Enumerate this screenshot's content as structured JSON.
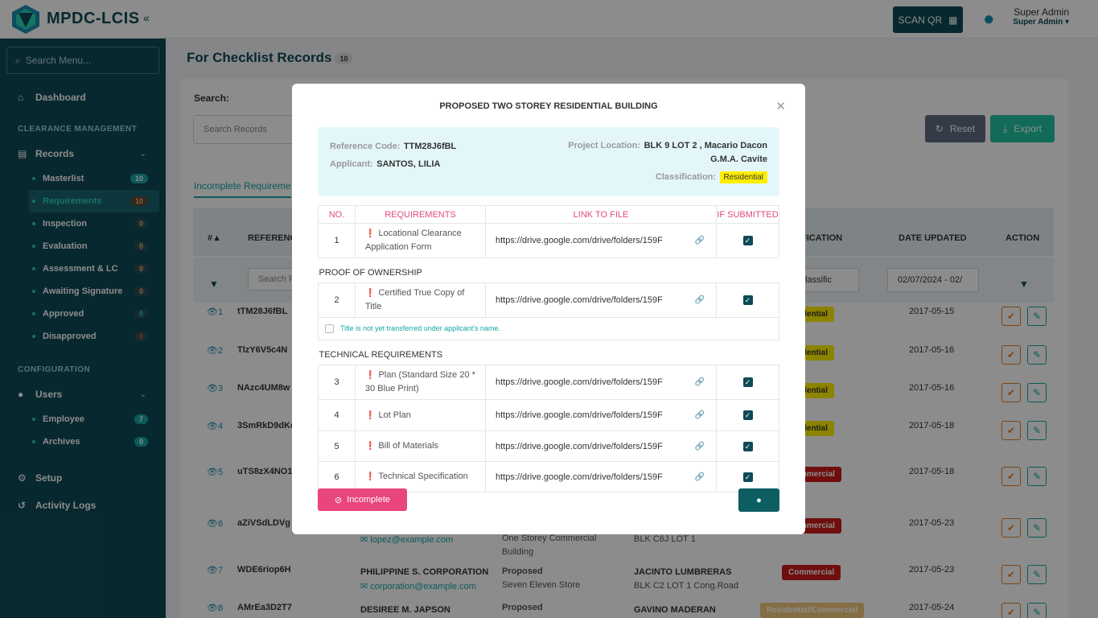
{
  "app": {
    "brand": "MPDC-LCIS",
    "collapse_icon": "«"
  },
  "search_menu": {
    "placeholder": "Search Menu..."
  },
  "nav": {
    "dashboard": "Dashboard",
    "section_clearance": "CLEARANCE MANAGEMENT",
    "records": "Records",
    "records_sub": [
      {
        "label": "Masterlist",
        "count": "10"
      },
      {
        "label": "Requirements",
        "count": "10"
      },
      {
        "label": "Inspection",
        "count": "0"
      },
      {
        "label": "Evaluation",
        "count": "0"
      },
      {
        "label": "Assessment & LC",
        "count": "0"
      },
      {
        "label": "Awaiting Signature",
        "count": "0"
      },
      {
        "label": "Approved",
        "count": "0"
      },
      {
        "label": "Disapproved",
        "count": "0"
      }
    ],
    "section_config": "CONFIGURATION",
    "users": "Users",
    "users_sub": [
      {
        "label": "Employee",
        "count": "7"
      },
      {
        "label": "Archives",
        "count": "0"
      }
    ],
    "setup": "Setup",
    "activity_logs": "Activity Logs"
  },
  "topbar": {
    "scan_qr": "SCAN QR",
    "user_name": "Super Admin",
    "user_role": "Super Admin"
  },
  "page": {
    "title": "For Checklist Records",
    "count": "10",
    "search_label": "Search:",
    "search_placeholder": "Search Records",
    "reset": "Reset",
    "export": "Export",
    "tab": "Incomplete Requireme",
    "columns": {
      "num": "#▲",
      "ref": "REFERENC",
      "classification": "FICATION",
      "date": "DATE UPDATED",
      "action": "ACTION"
    },
    "filter_search": "Search R",
    "filter_class": "Classific",
    "filter_date": "02/07/2024 - 02/",
    "rows": [
      {
        "n": "1",
        "ref": "tTM28J6fBL",
        "badge": "idential",
        "date": "2017-05-15"
      },
      {
        "n": "2",
        "ref": "TlzY6V5c4N",
        "badge": "idential",
        "date": "2017-05-16"
      },
      {
        "n": "3",
        "ref": "NAzc4UM8w",
        "badge": "idential",
        "date": "2017-05-16"
      },
      {
        "n": "4",
        "ref": "3SmRkD9dKc",
        "badge": "idential",
        "date": "2017-05-18"
      },
      {
        "n": "5",
        "ref": "uTS8zX4NO1",
        "badge": "mmercial",
        "date": "2017-05-18"
      },
      {
        "n": "6",
        "ref": "aZiVSdLDVg",
        "badge": "mmercial",
        "date": "2017-05-23",
        "email": "lopez@example.com",
        "proj": "One Storey Commercial",
        "proj2": "Building",
        "loc": "BLK C6J LOT 1"
      },
      {
        "n": "7",
        "ref": "WDE6riop6H",
        "badge": "Commercial",
        "date": "2017-05-23",
        "name": "PHILIPPINE S. CORPORATION",
        "email": "corporation@example.com",
        "proj": "Proposed",
        "proj2": "Seven Eleven Store",
        "loc": "JACINTO LUMBRERAS",
        "loc2": "BLK C2 LOT 1 Cong.Road"
      },
      {
        "n": "8",
        "ref": "AMrEa3D2T7",
        "badge": "Residential/Commercial",
        "date": "2017-05-24",
        "name": "DESIREE M. JAPSON",
        "proj": "Proposed",
        "loc": "GAVINO MADERAN"
      }
    ]
  },
  "modal": {
    "title": "PROPOSED TWO STOREY RESIDENTIAL BUILDING",
    "ref_label": "Reference Code:",
    "ref_value": "TTM28J6fBL",
    "applicant_label": "Applicant:",
    "applicant_value": "SANTOS, LILIA",
    "location_label": "Project Location:",
    "location_value1": "BLK 9 LOT 2 , Macario Dacon",
    "location_value2": "G.M.A. Cavite",
    "class_label": "Classification:",
    "class_value": "Residential",
    "headers": {
      "no": "NO.",
      "req": "REQUIREMENTS",
      "link": "LINK TO FILE",
      "sub": "IF SUBMITTED"
    },
    "items": [
      {
        "no": "1",
        "req": "Locational Clearance Application Form",
        "link": "https://drive.google.com/drive/folders/159F"
      },
      {
        "no": "2",
        "req": "Certified True Copy of Title",
        "link": "https://drive.google.com/drive/folders/159F"
      },
      {
        "no": "3",
        "req": "Plan (Standard Size 20 * 30 Blue Print)",
        "link": "https://drive.google.com/drive/folders/159F"
      },
      {
        "no": "4",
        "req": "Lot Plan",
        "link": "https://drive.google.com/drive/folders/159F"
      },
      {
        "no": "5",
        "req": "Bill of Materials",
        "link": "https://drive.google.com/drive/folders/159F"
      },
      {
        "no": "6",
        "req": "Technical Specification",
        "link": "https://drive.google.com/drive/folders/159F"
      }
    ],
    "section_ownership": "PROOF OF OWNERSHIP",
    "note": "Title is not yet transferred under applicant's name.",
    "section_technical": "TECHNICAL REQUIREMENTS",
    "incomplete_btn": "Incomplete"
  }
}
